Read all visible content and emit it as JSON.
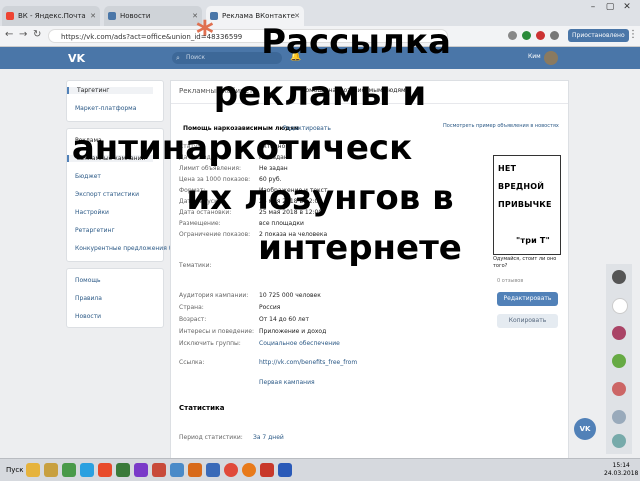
{
  "browser": {
    "tabs": [
      {
        "label": "ВК - Яндекс.Почта",
        "active": false
      },
      {
        "label": "Новости",
        "active": false
      },
      {
        "label": "Реклама ВКонтакте",
        "active": true
      }
    ],
    "url": "https://vk.com/ads?act=office&union_id=48336599",
    "profile_button": "Приостановлено"
  },
  "vk": {
    "logo": "VK",
    "search_placeholder": "Поиск",
    "user_name": "Ким",
    "sidebar_main": [
      {
        "label": "Таргетинг",
        "selected": true
      },
      {
        "label": "Маркет-платформа",
        "selected": false
      }
    ],
    "sidebar_cabinet": [
      {
        "label": "Рекламные кампании",
        "selected": true
      },
      {
        "label": "Бюджет",
        "selected": false
      },
      {
        "label": "Экспорт статистики",
        "selected": false
      },
      {
        "label": "Настройки",
        "selected": false
      },
      {
        "label": "Ретаргетинг",
        "selected": false
      },
      {
        "label": "Конкурентные предложения (0)",
        "selected": false
      }
    ],
    "sidebar_help": [
      "Помощь",
      "Правила",
      "Новости"
    ],
    "main": {
      "header": "Рекламный кабинет",
      "breadcrumb": "Помощь наркозависимым людям",
      "section_title": "Помощь наркозависимым людям",
      "edit_link": "Редактировать",
      "top_right_link": "Посмотреть пример объявления в новостях",
      "details": [
        {
          "label": "Статус:",
          "value": "Активно"
        },
        {
          "label": "Дата создания:",
          "value": "Не задан"
        },
        {
          "label": "Лимит объявления:",
          "value": "Не задан"
        },
        {
          "label": "Цена за 1000 показов:",
          "value": "60 руб."
        },
        {
          "label": "Формат:",
          "value": "Изображение и текст"
        },
        {
          "label": "Дата запуска:",
          "value": "25 мая 2018 в 12:00"
        },
        {
          "label": "Дата остановки:",
          "value": "25 мая 2018 в 12:00"
        },
        {
          "label": "Размещение:",
          "value": "все площадки"
        },
        {
          "label": "Ограничение показов:",
          "value": "2 показа на человека"
        }
      ],
      "subjects_label": "Тематики:",
      "audience": [
        {
          "label": "Аудитория кампании:",
          "value": "10 725 000 человек",
          "link": false
        },
        {
          "label": "Страна:",
          "value": "Россия",
          "link": false
        },
        {
          "label": "Возраст:",
          "value": "От 14 до 60 лет",
          "link": false
        },
        {
          "label": "Интересы и поведение:",
          "value": "Приложение и доход",
          "link": false
        },
        {
          "label": "Исключить группы:",
          "value": "Социальное обеспечение",
          "link": true
        }
      ],
      "link_label": "Ссылка:",
      "link_value": "http://vk.com/benefits_free_from",
      "link_note": "Первая кампания",
      "stats_title": "Статистика",
      "stats_period_label": "Период статистики:",
      "stats_period_value": "За 7 дней"
    },
    "promo": {
      "lines": [
        "НЕТ",
        "ВРЕДНОЙ",
        "ПРИВЫЧКЕ",
        "\"три Т\""
      ],
      "caption": "Одумайся, стоит ли оно того?",
      "subcaption": "0 отзывов",
      "edit_button": "Редактировать",
      "copy_button": "Копировать"
    }
  },
  "overlay_title": {
    "bullet": "*",
    "lines": [
      "Рассылка",
      "рекламы и",
      "антинаркотическ",
      "их лозунгов в",
      "интернете"
    ]
  },
  "taskbar": {
    "start_label": "Пуск",
    "time": "15:14",
    "date": "24.03.2018"
  },
  "colors": {
    "vk_blue": "#4a76a8",
    "link": "#2a5885",
    "bullet": "#e07050"
  }
}
